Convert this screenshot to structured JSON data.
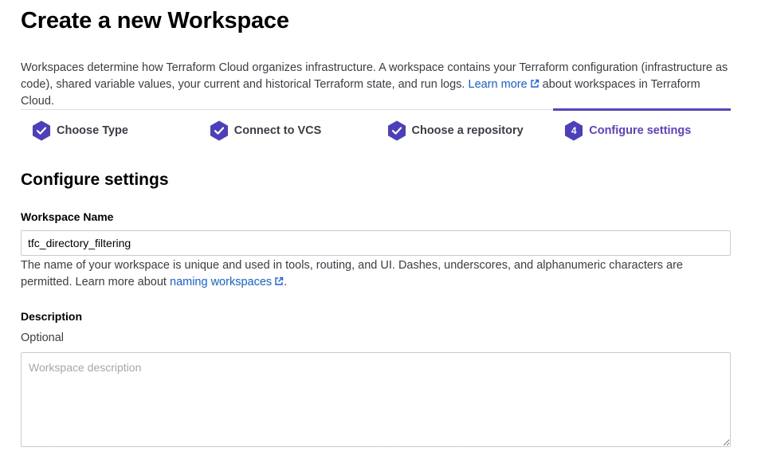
{
  "page": {
    "title": "Create a new Workspace"
  },
  "intro": {
    "text_before": "Workspaces determine how Terraform Cloud organizes infrastructure. A workspace contains your Terraform configuration (infrastructure as code), shared variable values, your current and historical Terraform state, and run logs. ",
    "link": "Learn more",
    "text_after": " about workspaces in Terraform Cloud."
  },
  "steps": [
    {
      "label": "Choose Type",
      "state": "complete",
      "icon": "check-icon"
    },
    {
      "label": "Connect to VCS",
      "state": "complete",
      "icon": "check-icon"
    },
    {
      "label": "Choose a repository",
      "state": "complete",
      "icon": "check-icon"
    },
    {
      "label": "Configure settings",
      "state": "active",
      "number": "4"
    }
  ],
  "section": {
    "title": "Configure settings"
  },
  "workspace_name": {
    "label": "Workspace Name",
    "value": "tfc_directory_filtering",
    "help_before": "The name of your workspace is unique and used in tools, routing, and UI. Dashes, underscores, and alphanumeric characters are permitted. Learn more about ",
    "help_link": "naming workspaces",
    "help_after": "."
  },
  "description": {
    "label": "Description",
    "optional": "Optional",
    "placeholder": "Workspace description",
    "value": ""
  },
  "colors": {
    "accent": "#5b3fd6",
    "step_badge": "#4b3fc0",
    "link": "#1060ff"
  }
}
